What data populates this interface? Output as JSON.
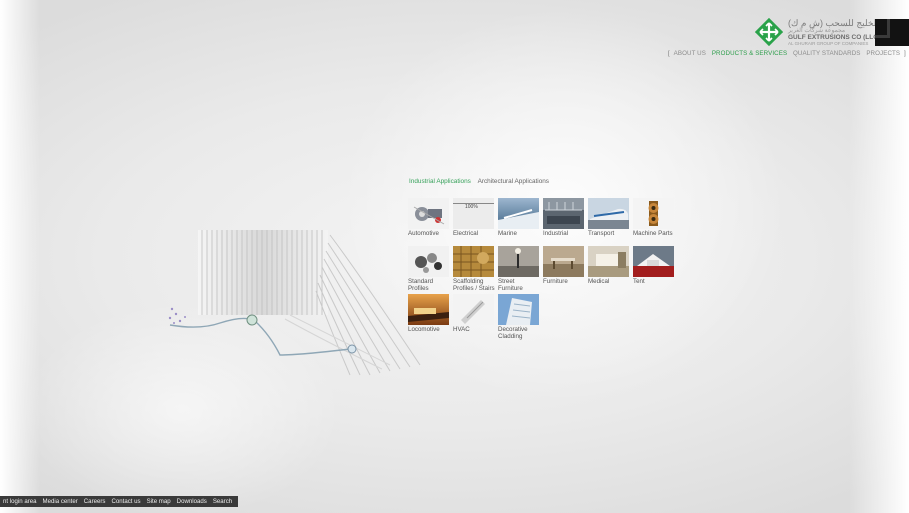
{
  "header": {
    "logo": {
      "arabic_name": "شركة الخليج للسحب (ش م ك)",
      "arabic_sub": "مجموعة شركات الغرير",
      "name": "GULF EXTRUSIONS CO (LLC)",
      "group": "AL GHURAIR GROUP OF COMPANIES"
    },
    "nav": {
      "open_bracket": "[",
      "items": [
        {
          "label": "ABOUT US",
          "active": false
        },
        {
          "label": "PRODUCTS & SERVICES",
          "active": true
        },
        {
          "label": "QUALITY STANDARDS",
          "active": false
        },
        {
          "label": "PROJECTS",
          "active": false
        }
      ],
      "close_bracket": "]"
    }
  },
  "tabs": {
    "industrial": "Industrial Applications",
    "architectural": "Architectural Applications"
  },
  "loading_text": "100%",
  "applications": [
    {
      "label": "Automotive",
      "icon": "automotive-icon"
    },
    {
      "label": "Electrical",
      "icon": "electrical-icon"
    },
    {
      "label": "Marine",
      "icon": "marine-icon"
    },
    {
      "label": "Industrial",
      "icon": "industrial-icon"
    },
    {
      "label": "Transport",
      "icon": "transport-icon"
    },
    {
      "label": "Machine Parts",
      "icon": "machine-parts-icon"
    },
    {
      "label": "Standard Profiles",
      "line1": "Standard",
      "line2": "Profiles",
      "icon": "standard-profiles-icon"
    },
    {
      "label": "Scaffolding Profiles / Stairs",
      "line1": "Scaffolding",
      "line2": "Profiles / Stairs",
      "icon": "scaffolding-icon"
    },
    {
      "label": "Street Furniture",
      "line1": "Street",
      "line2": "Furniture",
      "icon": "street-furniture-icon"
    },
    {
      "label": "Furniture",
      "icon": "furniture-icon"
    },
    {
      "label": "Medical",
      "icon": "medical-icon"
    },
    {
      "label": "Tent",
      "icon": "tent-icon"
    },
    {
      "label": "Locomotive",
      "icon": "locomotive-icon"
    },
    {
      "label": "HVAC",
      "icon": "hvac-icon"
    },
    {
      "label": "Decorative Cladding",
      "line1": "Decorative",
      "line2": "Cladding",
      "icon": "decorative-cladding-icon"
    }
  ],
  "footer": {
    "items": [
      "nt login area",
      "Media center",
      "Careers",
      "Contact us",
      "Site map",
      "Downloads",
      "Search"
    ]
  },
  "colors": {
    "accent": "#36a15a",
    "footer_bg": "#3a3a3a",
    "logo_green": "#2aa24a"
  }
}
